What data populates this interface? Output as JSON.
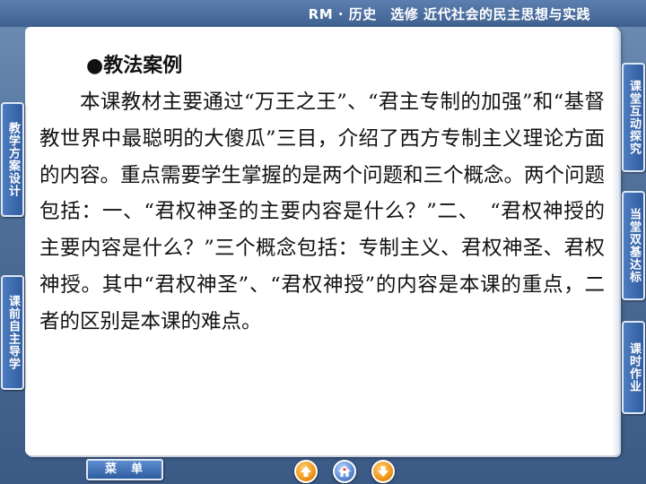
{
  "header": {
    "title": "RM · 历史　选修  近代社会的民主思想与实践"
  },
  "content": {
    "heading": "●教法案例",
    "paragraph": "本课教材主要通过“万王之王”、“君主专制的加强”和“基督教世界中最聪明的大傻瓜”三目，介绍了西方专制主义理论方面的内容。重点需要学生掌握的是两个问题和三个概念。两个问题包括：一、“君权神圣的主要内容是什么？”二、　“君权神授的主要内容是什么？”三个概念包括：专制主义、君权神圣、君权神授。其中“君权神圣”、“君权神授”的内容是本课的重点，二者的区别是本课的难点。"
  },
  "left_tabs": [
    {
      "label": "教学方案设计"
    },
    {
      "label": "课前自主导学"
    }
  ],
  "right_tabs": [
    {
      "label": "课堂互动探究"
    },
    {
      "label": "当堂双基达标"
    },
    {
      "label": "课时作业"
    }
  ],
  "bottom": {
    "menu_label": "菜单",
    "icons": [
      "up-arrow-icon",
      "home-icon",
      "down-arrow-icon"
    ]
  },
  "colors": {
    "background": "#4f6f99",
    "tab": "#2f5d9f",
    "nav_orange": "#f29a1e"
  }
}
